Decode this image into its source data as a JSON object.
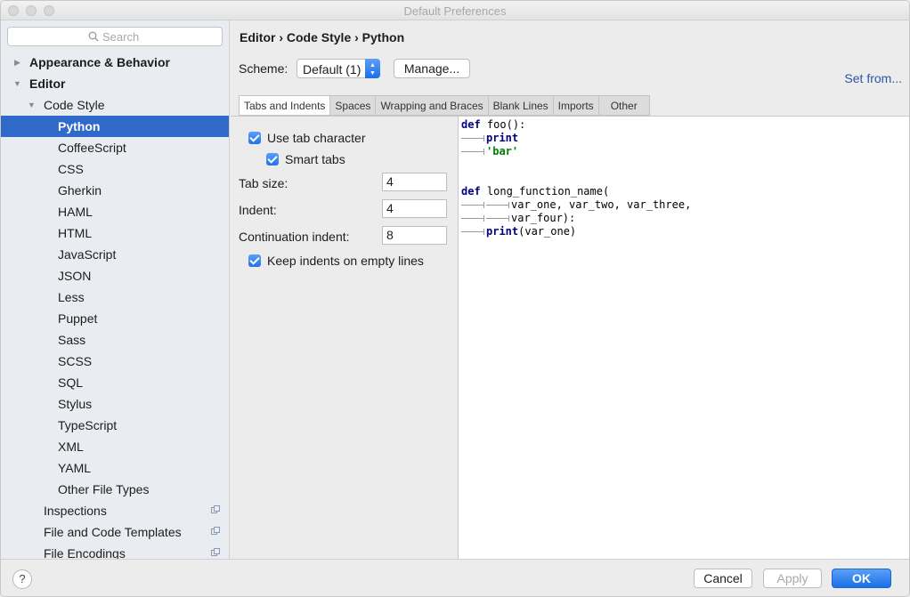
{
  "window": {
    "title": "Default Preferences"
  },
  "search": {
    "placeholder": "Search",
    "icon": "search-icon"
  },
  "sidebar": {
    "items": [
      {
        "label": "Appearance & Behavior",
        "indent": 0,
        "bold": true,
        "arrow": "right"
      },
      {
        "label": "Editor",
        "indent": 0,
        "bold": true,
        "arrow": "down"
      },
      {
        "label": "Code Style",
        "indent": 1,
        "bold": false,
        "arrow": "down"
      },
      {
        "label": "Python",
        "indent": 2,
        "bold": false,
        "selected": true
      },
      {
        "label": "CoffeeScript",
        "indent": 2
      },
      {
        "label": "CSS",
        "indent": 2
      },
      {
        "label": "Gherkin",
        "indent": 2
      },
      {
        "label": "HAML",
        "indent": 2
      },
      {
        "label": "HTML",
        "indent": 2
      },
      {
        "label": "JavaScript",
        "indent": 2
      },
      {
        "label": "JSON",
        "indent": 2
      },
      {
        "label": "Less",
        "indent": 2
      },
      {
        "label": "Puppet",
        "indent": 2
      },
      {
        "label": "Sass",
        "indent": 2
      },
      {
        "label": "SCSS",
        "indent": 2
      },
      {
        "label": "SQL",
        "indent": 2
      },
      {
        "label": "Stylus",
        "indent": 2
      },
      {
        "label": "TypeScript",
        "indent": 2
      },
      {
        "label": "XML",
        "indent": 2
      },
      {
        "label": "YAML",
        "indent": 2
      },
      {
        "label": "Other File Types",
        "indent": 2
      },
      {
        "label": "Inspections",
        "indent": 1,
        "copy_icon": true
      },
      {
        "label": "File and Code Templates",
        "indent": 1,
        "copy_icon": true
      },
      {
        "label": "File Encodings",
        "indent": 1,
        "copy_icon": true
      }
    ]
  },
  "main": {
    "breadcrumb": "Editor › Code Style › Python",
    "scheme_label": "Scheme:",
    "scheme_value": "Default (1)",
    "manage_label": "Manage...",
    "set_from_label": "Set from...",
    "tabs": [
      "Tabs and Indents",
      "Spaces",
      "Wrapping and Braces",
      "Blank Lines",
      "Imports",
      "Other"
    ],
    "active_tab": "Tabs and Indents",
    "options": {
      "use_tab_character": {
        "label": "Use tab character",
        "checked": true
      },
      "smart_tabs": {
        "label": "Smart tabs",
        "checked": true
      },
      "tab_size": {
        "label": "Tab size:",
        "value": "4"
      },
      "indent": {
        "label": "Indent:",
        "value": "4"
      },
      "continuation_indent": {
        "label": "Continuation indent:",
        "value": "8"
      },
      "keep_indents": {
        "label": "Keep indents on empty lines",
        "checked": true
      }
    },
    "preview": {
      "lines": [
        "def foo():",
        "print",
        "'bar'",
        "def long_function_name(",
        "var_one, var_two, var_three,",
        "var_four):",
        "print(var_one)"
      ]
    }
  },
  "buttons": {
    "help": "?",
    "cancel": "Cancel",
    "apply": "Apply",
    "ok": "OK"
  },
  "colors": {
    "accent": "#2f69c9",
    "keyword": "#000080",
    "string": "#008000",
    "link": "#2b55a6"
  }
}
